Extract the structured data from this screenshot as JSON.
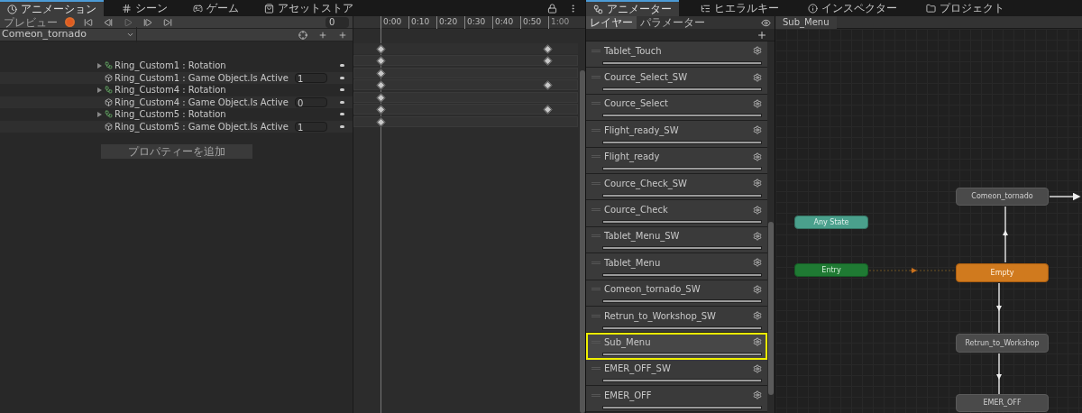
{
  "animation_window": {
    "tabs": [
      {
        "label": "アニメーション",
        "kind": "clock",
        "selected": true
      },
      {
        "label": "シーン",
        "kind": "hash",
        "selected": false
      },
      {
        "label": "ゲーム",
        "kind": "gamepad",
        "selected": false
      },
      {
        "label": "アセットストア",
        "kind": "bag",
        "selected": false
      }
    ],
    "preview_label": "プレビュー",
    "frame_value": "0",
    "clip_name": "Comeon_tornado",
    "ruler_labels": [
      "0:00",
      "0:10",
      "0:20",
      "0:30",
      "0:40",
      "0:50",
      "1:00"
    ],
    "summary_key_end": true,
    "properties": [
      {
        "kind": "rotation",
        "label": "Ring_Custom1 : Rotation",
        "key_end": true
      },
      {
        "kind": "active",
        "label": "Ring_Custom1 : Game Object.Is Active",
        "value": "1",
        "key_end": false
      },
      {
        "kind": "rotation",
        "label": "Ring_Custom4 : Rotation",
        "key_end": true
      },
      {
        "kind": "active",
        "label": "Ring_Custom4 : Game Object.Is Active",
        "value": "0",
        "key_end": false
      },
      {
        "kind": "rotation",
        "label": "Ring_Custom5 : Rotation",
        "key_end": true
      },
      {
        "kind": "active",
        "label": "Ring_Custom5 : Game Object.Is Active",
        "value": "1",
        "key_end": false
      }
    ],
    "add_property_button": "プロパティーを追加"
  },
  "right_tabs": [
    {
      "label": "アニメーター",
      "kind": "animator",
      "selected": true
    },
    {
      "label": "ヒエラルキー",
      "kind": "list",
      "selected": false
    },
    {
      "label": "インスペクター",
      "kind": "info",
      "selected": false
    },
    {
      "label": "プロジェクト",
      "kind": "folder",
      "selected": false
    }
  ],
  "animator": {
    "subtabs": [
      {
        "label": "レイヤー",
        "selected": true
      },
      {
        "label": "パラメーター",
        "selected": false
      }
    ],
    "breadcrumb": "Sub_Menu",
    "layers": [
      {
        "name": "Tablet_Touch",
        "selected": false,
        "level": 1
      },
      {
        "name": "Cource_Select_SW",
        "selected": false,
        "level": 1
      },
      {
        "name": "Cource_Select",
        "selected": false,
        "level": 1
      },
      {
        "name": "Flight_ready_SW",
        "selected": false,
        "level": 1
      },
      {
        "name": "Flight_ready",
        "selected": false,
        "level": 1
      },
      {
        "name": "Cource_Check_SW",
        "selected": false,
        "level": 1
      },
      {
        "name": "Cource_Check",
        "selected": false,
        "level": 1
      },
      {
        "name": "Tablet_Menu_SW",
        "selected": false,
        "level": 1
      },
      {
        "name": "Tablet_Menu",
        "selected": false,
        "level": 1
      },
      {
        "name": "Comeon_tornado_SW",
        "selected": false,
        "level": 1
      },
      {
        "name": "Retrun_to_Workshop_SW",
        "selected": false,
        "level": 1
      },
      {
        "name": "Sub_Menu",
        "selected": true,
        "level": 1
      },
      {
        "name": "EMER_OFF_SW",
        "selected": false,
        "level": 1
      },
      {
        "name": "EMER_OFF",
        "selected": false,
        "level": 1
      }
    ],
    "states": [
      {
        "name": "Comeon_tornado",
        "kind": "state"
      },
      {
        "name": "Any State",
        "kind": "any"
      },
      {
        "name": "Entry",
        "kind": "entry"
      },
      {
        "name": "Empty",
        "kind": "default"
      },
      {
        "name": "Retrun_to_Workshop",
        "kind": "state"
      },
      {
        "name": "EMER_OFF",
        "kind": "state"
      }
    ]
  }
}
